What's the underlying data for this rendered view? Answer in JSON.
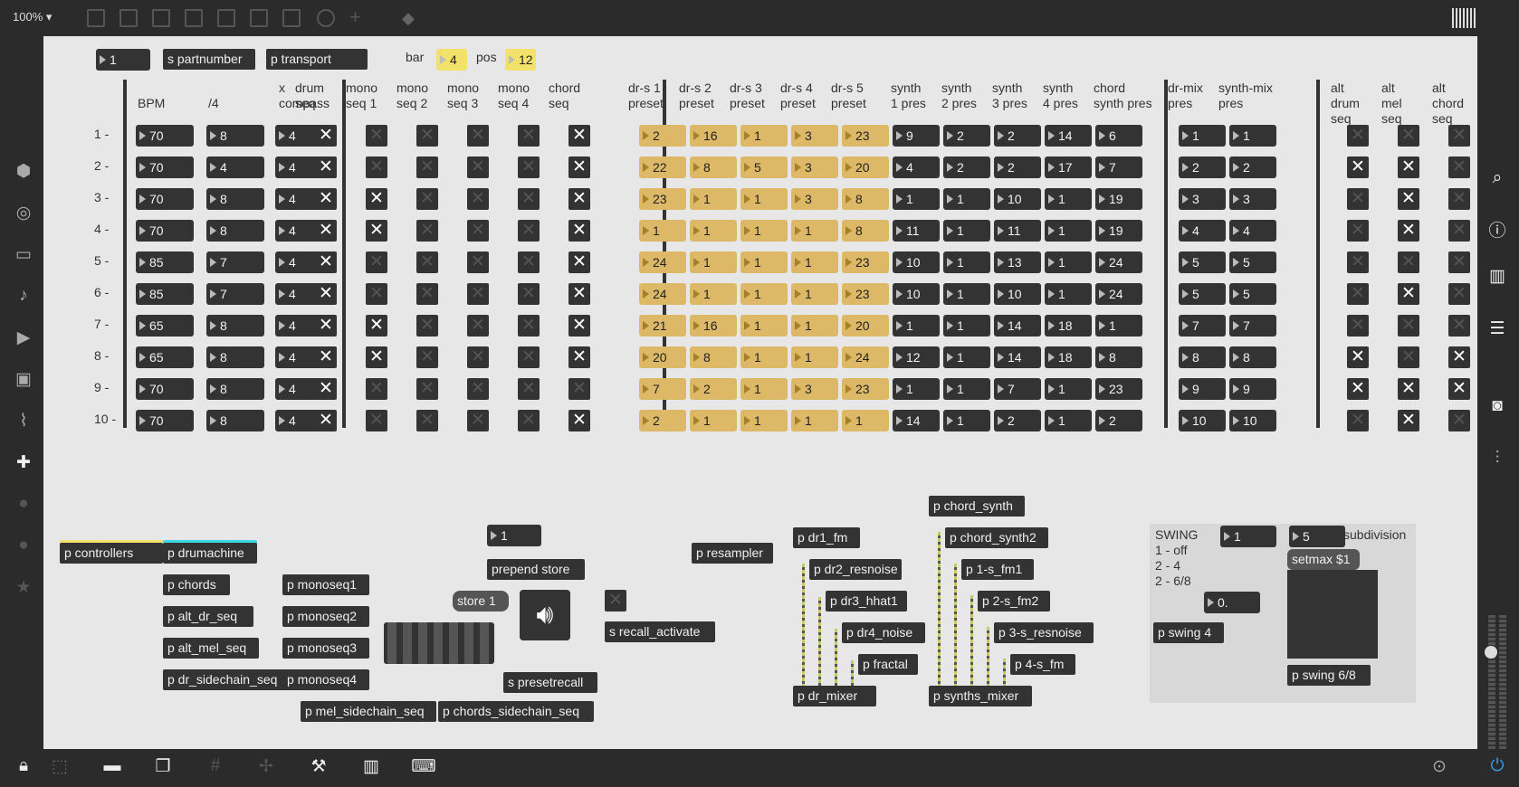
{
  "zoom": "100%",
  "header": {
    "partnumber_value": "1",
    "s_partnumber": "s partnumber",
    "p_transport": "p transport",
    "bar_label": "bar",
    "bar_value": "4",
    "pos_label": "pos",
    "pos_value": "12"
  },
  "colors": {
    "preset_gold": "#dcb867",
    "accent_yellow": "#f2e26a",
    "drumachine_cyan": "#3ad8e6",
    "object_dark": "#333333",
    "canvas": "#e7e7e7"
  },
  "columns": {
    "bpm": "BPM",
    "quarter": "/4",
    "compass": "x\ncompass",
    "seqs": [
      "drum\nseq",
      "mono\nseq 1",
      "mono\nseq 2",
      "mono\nseq 3",
      "mono\nseq 4",
      "chord\nseq"
    ],
    "drs": [
      "dr-s 1\npreset",
      "dr-s 2\npreset",
      "dr-s 3\npreset",
      "dr-s 4\npreset",
      "dr-s 5\npreset"
    ],
    "synths": [
      "synth\n1 pres",
      "synth\n2 pres",
      "synth\n3 pres",
      "synth\n4 pres",
      "chord\nsynth pres"
    ],
    "mix": [
      "dr-mix\npres",
      "synth-mix\npres"
    ],
    "alt": [
      "alt\ndrum\nseq",
      "alt\nmel\nseq",
      "alt\nchord\nseq"
    ]
  },
  "rows": [
    {
      "label": "1 -",
      "bpm": "70",
      "q": "8",
      "x": "4",
      "seq": [
        1,
        0,
        0,
        0,
        0,
        1
      ],
      "drs": [
        "2",
        "16",
        "1",
        "3",
        "23"
      ],
      "syn": [
        "9",
        "2",
        "2",
        "14",
        "6"
      ],
      "mix": [
        "1",
        "1"
      ],
      "alt": [
        0,
        0,
        0
      ]
    },
    {
      "label": "2 -",
      "bpm": "70",
      "q": "4",
      "x": "4",
      "seq": [
        1,
        0,
        0,
        0,
        0,
        1
      ],
      "drs": [
        "22",
        "8",
        "5",
        "3",
        "20"
      ],
      "syn": [
        "4",
        "2",
        "2",
        "17",
        "7"
      ],
      "mix": [
        "2",
        "2"
      ],
      "alt": [
        1,
        1,
        0
      ]
    },
    {
      "label": "3 -",
      "bpm": "70",
      "q": "8",
      "x": "4",
      "seq": [
        1,
        1,
        0,
        0,
        0,
        1
      ],
      "drs": [
        "23",
        "1",
        "1",
        "3",
        "8"
      ],
      "syn": [
        "1",
        "1",
        "10",
        "1",
        "19"
      ],
      "mix": [
        "3",
        "3"
      ],
      "alt": [
        0,
        1,
        0
      ]
    },
    {
      "label": "4 -",
      "bpm": "70",
      "q": "8",
      "x": "4",
      "seq": [
        1,
        1,
        0,
        0,
        0,
        1
      ],
      "drs": [
        "1",
        "1",
        "1",
        "1",
        "8"
      ],
      "syn": [
        "11",
        "1",
        "11",
        "1",
        "19"
      ],
      "mix": [
        "4",
        "4"
      ],
      "alt": [
        0,
        1,
        0
      ]
    },
    {
      "label": "5 -",
      "bpm": "85",
      "q": "7",
      "x": "4",
      "seq": [
        1,
        0,
        0,
        0,
        0,
        1
      ],
      "drs": [
        "24",
        "1",
        "1",
        "1",
        "23"
      ],
      "syn": [
        "10",
        "1",
        "13",
        "1",
        "24"
      ],
      "mix": [
        "5",
        "5"
      ],
      "alt": [
        0,
        0,
        0
      ]
    },
    {
      "label": "6 -",
      "bpm": "85",
      "q": "7",
      "x": "4",
      "seq": [
        1,
        0,
        0,
        0,
        0,
        1
      ],
      "drs": [
        "24",
        "1",
        "1",
        "1",
        "23"
      ],
      "syn": [
        "10",
        "1",
        "10",
        "1",
        "24"
      ],
      "mix": [
        "5",
        "5"
      ],
      "alt": [
        0,
        1,
        0
      ]
    },
    {
      "label": "7 -",
      "bpm": "65",
      "q": "8",
      "x": "4",
      "seq": [
        1,
        1,
        0,
        0,
        0,
        1
      ],
      "drs": [
        "21",
        "16",
        "1",
        "1",
        "20"
      ],
      "syn": [
        "1",
        "1",
        "14",
        "18",
        "1"
      ],
      "mix": [
        "7",
        "7"
      ],
      "alt": [
        0,
        0,
        0
      ]
    },
    {
      "label": "8 -",
      "bpm": "65",
      "q": "8",
      "x": "4",
      "seq": [
        1,
        1,
        0,
        0,
        0,
        1
      ],
      "drs": [
        "20",
        "8",
        "1",
        "1",
        "24"
      ],
      "syn": [
        "12",
        "1",
        "14",
        "18",
        "8"
      ],
      "mix": [
        "8",
        "8"
      ],
      "alt": [
        1,
        0,
        1
      ]
    },
    {
      "label": "9 -",
      "bpm": "70",
      "q": "8",
      "x": "4",
      "seq": [
        1,
        0,
        0,
        0,
        0,
        0
      ],
      "drs": [
        "7",
        "2",
        "1",
        "3",
        "23"
      ],
      "syn": [
        "1",
        "1",
        "7",
        "1",
        "23"
      ],
      "mix": [
        "9",
        "9"
      ],
      "alt": [
        1,
        1,
        1
      ]
    },
    {
      "label": "10 -",
      "bpm": "70",
      "q": "8",
      "x": "4",
      "seq": [
        1,
        0,
        0,
        0,
        0,
        1
      ],
      "drs": [
        "2",
        "1",
        "1",
        "1",
        "1"
      ],
      "syn": [
        "14",
        "1",
        "2",
        "1",
        "2"
      ],
      "mix": [
        "10",
        "10"
      ],
      "alt": [
        0,
        1,
        0
      ]
    }
  ],
  "patchers": {
    "controllers": "p controllers",
    "drumachine": "p drumachine",
    "chords": "p chords",
    "alt_dr_seq": "p alt_dr_seq",
    "alt_mel_seq": "p alt_mel_seq",
    "dr_sidechain_seq": "p dr_sidechain_seq",
    "monoseq1": "p monoseq1",
    "monoseq2": "p monoseq2",
    "monoseq3": "p monoseq3",
    "monoseq4": "p monoseq4",
    "mel_sidechain_seq": "p mel_sidechain_seq",
    "chords_sidechain_seq": "p chords_sidechain_seq",
    "store_num": "1",
    "prepend_store": "prepend store",
    "store_1": "store 1",
    "s_presetrecall": "s presetrecall",
    "s_recall_activate": "s recall_activate",
    "p_resampler": "p resampler",
    "dr1_fm": "p dr1_fm",
    "dr2_resnoise": "p dr2_resnoise",
    "dr3_hhat1": "p dr3_hhat1",
    "dr4_noise": "p dr4_noise",
    "fractal": "p fractal",
    "dr_mixer": "p dr_mixer",
    "chord_synth": "p chord_synth",
    "chord_synth2": "p chord_synth2",
    "s1_fm1": "p 1-s_fm1",
    "s2_fm2": "p 2-s_fm2",
    "s3_resnoise": "p 3-s_resnoise",
    "s4_fm": "p 4-s_fm",
    "synths_mixer": "p synths_mixer"
  },
  "swing": {
    "title": "SWING",
    "opt1": "1 - off",
    "opt2": "2 - 4",
    "opt3": "2 - 6/8",
    "swing_num": "1",
    "subdiv_num": "5",
    "subdivision_label": "subdivision",
    "setmax": "setmax $1",
    "float_num": "0.",
    "p_swing4": "p swing 4",
    "p_swing68": "p swing 6/8"
  }
}
